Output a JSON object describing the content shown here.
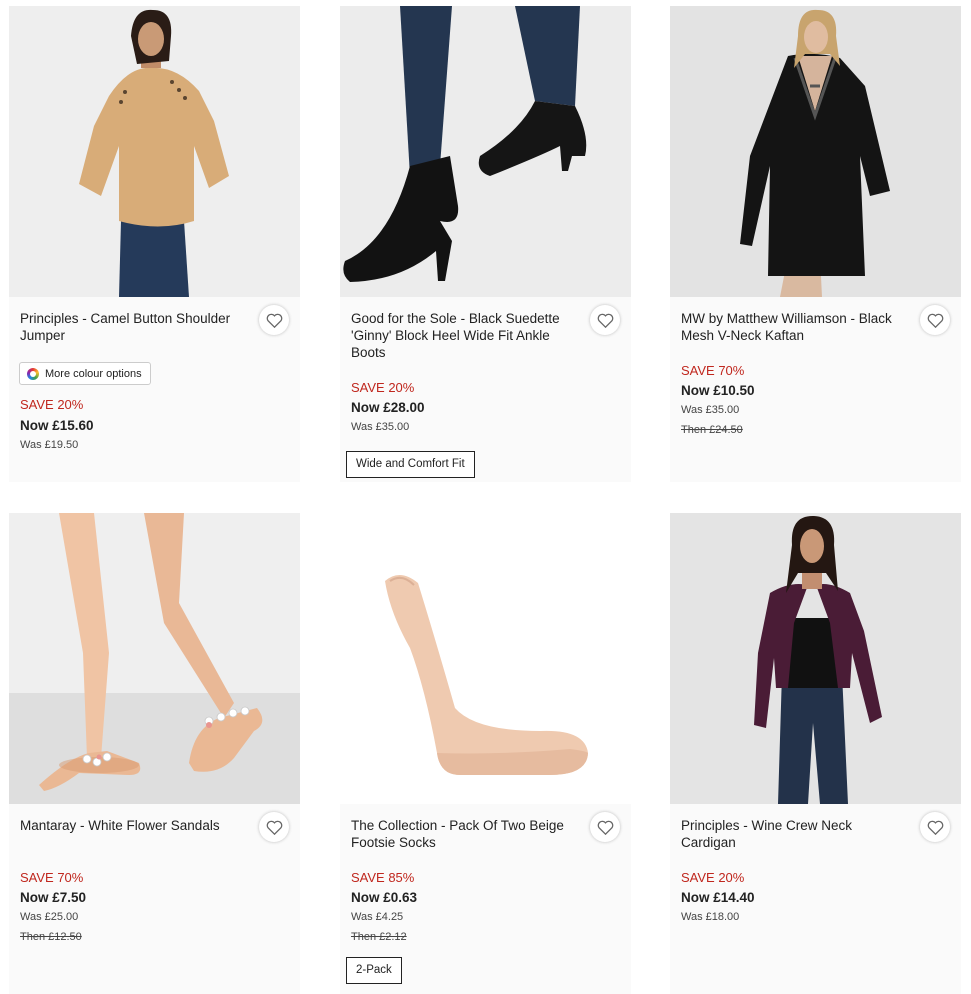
{
  "products": [
    {
      "title": "Principles - Camel Button Shoulder Jumper",
      "colour_options": "More colour options",
      "save": "SAVE 20%",
      "now": "Now £15.60",
      "was": "Was £19.50",
      "image": "model-camel-jumper"
    },
    {
      "title": "Good for the Sole - Black Suedette 'Ginny' Block Heel Wide Fit Ankle Boots",
      "save": "SAVE 20%",
      "now": "Now £28.00",
      "was": "Was £35.00",
      "badge": "Wide and Comfort Fit",
      "image": "black-ankle-boots"
    },
    {
      "title": "MW by Matthew Williamson - Black Mesh V-Neck Kaftan",
      "save": "SAVE 70%",
      "now": "Now £10.50",
      "was": "Was £35.00",
      "then": "Then £24.50",
      "image": "model-black-kaftan"
    },
    {
      "title": "Mantaray - White Flower Sandals",
      "save": "SAVE 70%",
      "now": "Now £7.50",
      "was": "Was £25.00",
      "then": "Then £12.50",
      "image": "flower-sandals"
    },
    {
      "title": "The Collection - Pack Of Two Beige Footsie Socks",
      "save": "SAVE 85%",
      "now": "Now £0.63",
      "was": "Was £4.25",
      "then": "Then £2.12",
      "badge": "2-Pack",
      "image": "beige-footsie-sock"
    },
    {
      "title": "Principles - Wine Crew Neck Cardigan",
      "save": "SAVE 20%",
      "now": "Now £14.40",
      "was": "Was £18.00",
      "image": "model-wine-cardigan"
    }
  ],
  "colors": {
    "save": "#c0271e",
    "card_bg": "#fafafa"
  }
}
